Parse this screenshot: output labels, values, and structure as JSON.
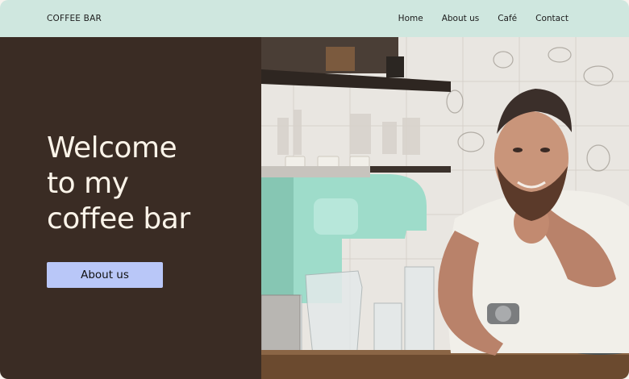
{
  "header": {
    "brand": "COFFEE BAR",
    "nav": [
      "Home",
      "About us",
      "Café",
      "Contact"
    ]
  },
  "hero": {
    "headline_lines": [
      "Welcome",
      "to my",
      "coffee bar"
    ],
    "cta_label": "About us"
  },
  "colors": {
    "topbar": "#cfe7df",
    "left_panel": "#3a2c24",
    "headline": "#fbf4e9",
    "button": "#b9c7f8",
    "machine_accent": "#9edcca"
  },
  "image": {
    "subject": "barista smiling behind a counter with a mint espresso machine and glassware"
  }
}
